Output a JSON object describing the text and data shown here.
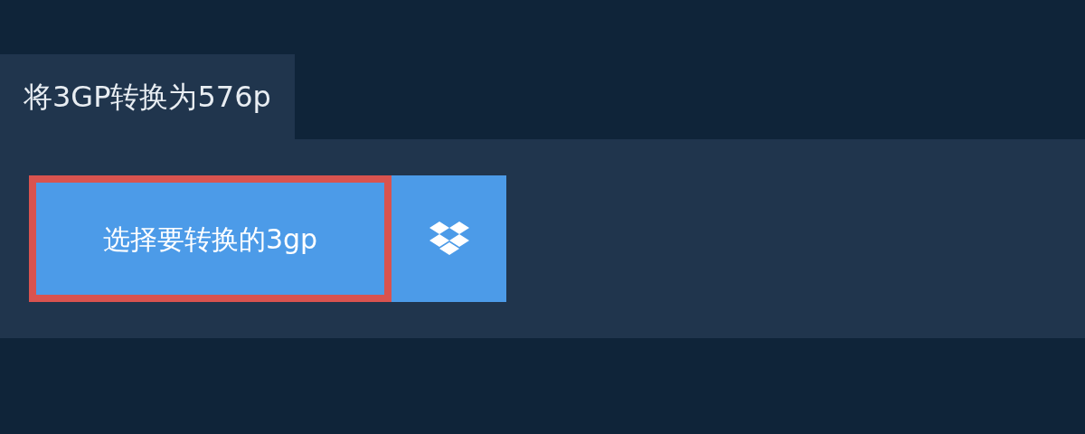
{
  "tab": {
    "title": "将3GP转换为576p"
  },
  "upload": {
    "label": "选择要转换的3gp",
    "focused": true
  }
}
